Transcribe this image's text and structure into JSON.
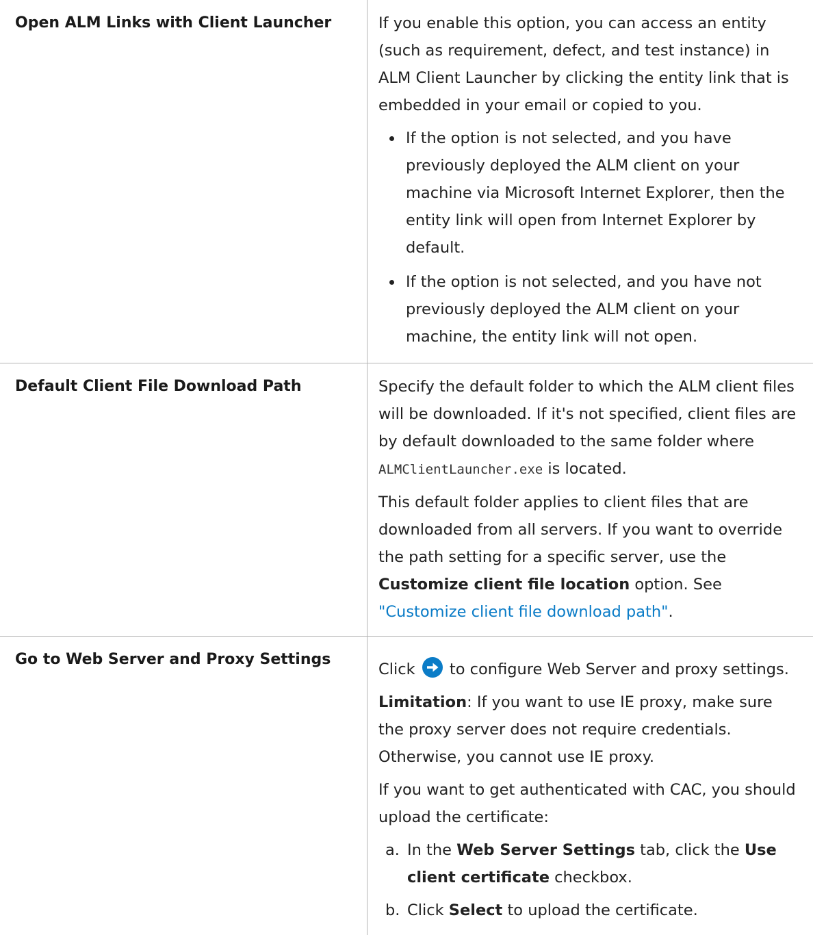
{
  "rows": [
    {
      "name": "Open ALM Links with Client Launcher",
      "intro": "If you enable this option, you can access an entity (such as requirement, defect, and test instance) in ALM Client Launcher by clicking the entity link that is embedded in your email or copied to you.",
      "bullets": [
        "If the option is not selected, and you have previously deployed the ALM client on your machine via Microsoft Internet Explorer, then the entity link will open from Internet Explorer by default.",
        "If the option is not selected, and you have not previously deployed the ALM client on your machine, the entity link will not open."
      ]
    },
    {
      "name": "Default Client File Download Path",
      "p1_before": "Specify the default folder to which the ALM client files will be downloaded. If it's not specified, client files are by default downloaded to the same folder where ",
      "p1_code": "ALMClientLauncher.exe",
      "p1_after": " is located.",
      "p2_before": "This default folder applies to client files that are downloaded from all servers. If you want to override the path setting for a specific server, use the ",
      "p2_bold": "Customize client file location",
      "p2_mid": " option. See ",
      "p2_link": "\"Customize client file download path\"",
      "p2_after": "."
    },
    {
      "name": "Go to Web Server and Proxy Settings",
      "click_before": "Click",
      "click_after": " to configure Web Server and proxy settings.",
      "icon": "arrow-right-circle-icon",
      "icon_color": "#0b7cc7",
      "limitation_label": "Limitation",
      "limitation_text": ": If you want to use IE proxy, make sure the proxy server does not require credentials. Otherwise, you cannot use IE proxy.",
      "cac_text": "If you want to get authenticated with CAC, you should upload the certificate:",
      "steps": [
        {
          "marker": "a.",
          "t1": "In the ",
          "b1": "Web Server Settings",
          "t2": " tab, click the ",
          "b2": "Use client certificate",
          "t3": " checkbox."
        },
        {
          "marker": "b.",
          "t1": "Click ",
          "b1": "Select",
          "t2": " to upload the certificate."
        }
      ]
    }
  ]
}
